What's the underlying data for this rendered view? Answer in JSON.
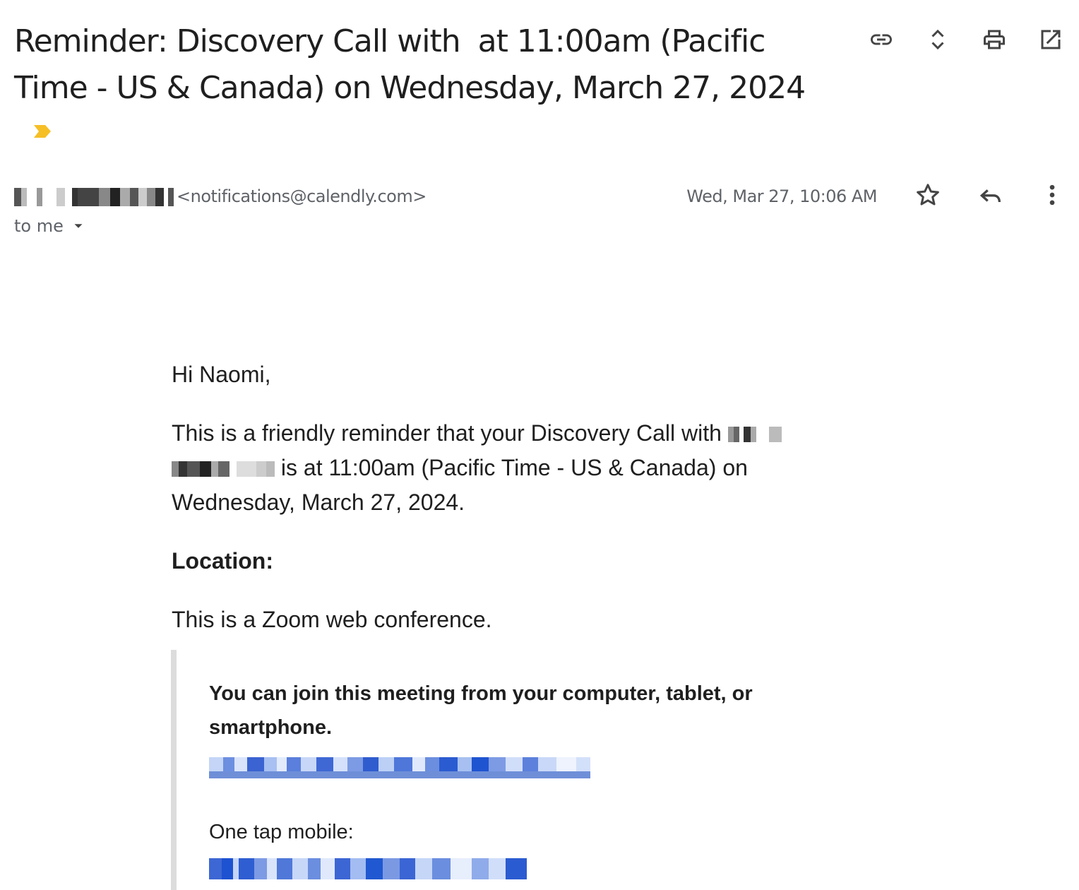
{
  "email": {
    "subject": {
      "prefix": "Reminder: Discovery Call with",
      "suffix": "at 11:00am (Pacific Time - US & Canada) on Wednesday, March 27, 2024"
    },
    "sender": {
      "email": "<notifications@calendly.com>"
    },
    "date": "Wed, Mar 27, 10:06 AM",
    "recipient": "to me",
    "body": {
      "greeting": "Hi Naomi,",
      "reminder_start": "This is a friendly reminder that your Discovery Call with",
      "reminder_end": "is at 11:00am (Pacific Time - US & Canada) on Wednesday, March 27, 2024.",
      "location_label": "Location:",
      "location_text": "This is a Zoom web conference.",
      "join_text": "You can join this meeting from your computer, tablet, or smartphone.",
      "mobile_label": "One tap mobile:"
    }
  },
  "icons": {
    "top_actions": [
      "link-icon",
      "expand-collapse-icon",
      "print-icon",
      "open-in-new-window-icon"
    ],
    "row_actions": [
      "star-icon",
      "reply-icon",
      "more-vert-icon"
    ],
    "label": "important-marker-icon",
    "dropdown": "caret-down-icon"
  },
  "colors": {
    "important_marker": "#f6bf26",
    "text_primary": "#1f1f1f",
    "text_secondary": "#5f6368",
    "quote_border": "#dcdcdc",
    "link": "#1a56d6"
  }
}
